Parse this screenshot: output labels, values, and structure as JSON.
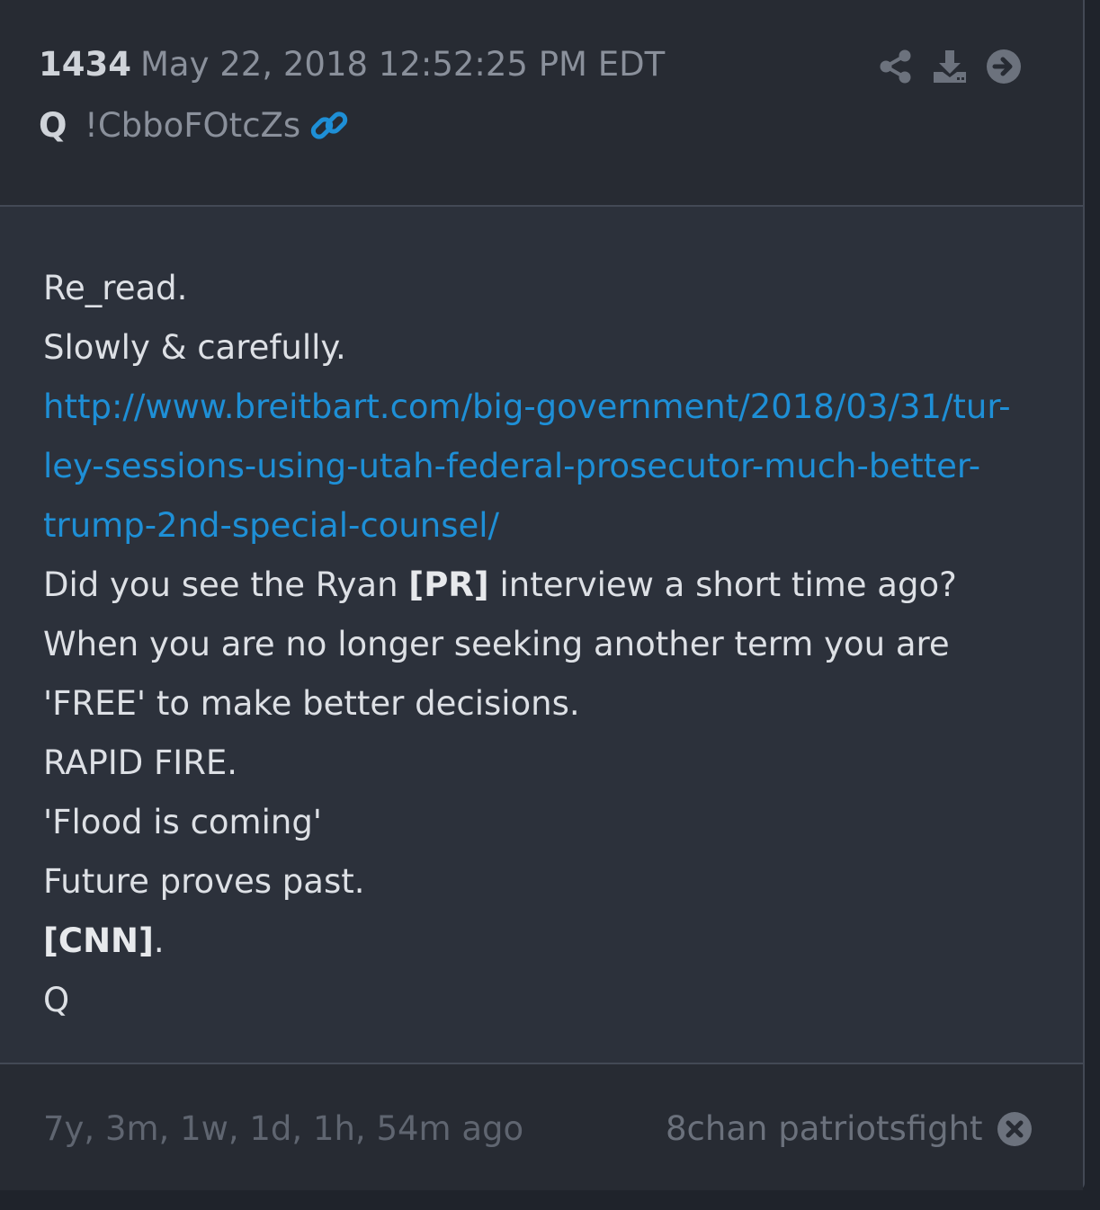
{
  "post": {
    "number": "1434",
    "date": "May 22, 2018 12:52:25 PM EDT",
    "author": "Q",
    "tripcode": "!CbboFOtcZs"
  },
  "icons": {
    "link": "link-icon",
    "share": "share-icon",
    "download": "download-icon",
    "navigate": "arrow-right-circle-icon",
    "close": "close-circle-icon"
  },
  "colors": {
    "link": "#1e8fd6",
    "card": "#2c313b",
    "header": "#272b33"
  },
  "body": {
    "line1": "Re_read.",
    "line2": "Slowly & carefully.",
    "url_line1": "http://www.breitbart.com/big-government/2018/03/31/tur-",
    "url_line2": "ley-sessions-using-utah-federal-prosecutor-much-better-",
    "url_line3": "trump-2nd-special-counsel/",
    "line4_pre": "Did you see the Ryan ",
    "line4_bold": "[PR]",
    "line4_post": " interview a short time ago?",
    "line5": "When you are no longer seeking another term you are",
    "line6": "'FREE' to make better decisions.",
    "line7": "RAPID FIRE.",
    "line8": "'Flood is coming'",
    "line9": "Future proves past.",
    "line10_bold": "[CNN]",
    "line10_post": ".",
    "line11": "Q"
  },
  "footer": {
    "age": "7y, 3m, 1w, 1d, 1h, 54m ago",
    "source": "8chan patriotsfight"
  }
}
